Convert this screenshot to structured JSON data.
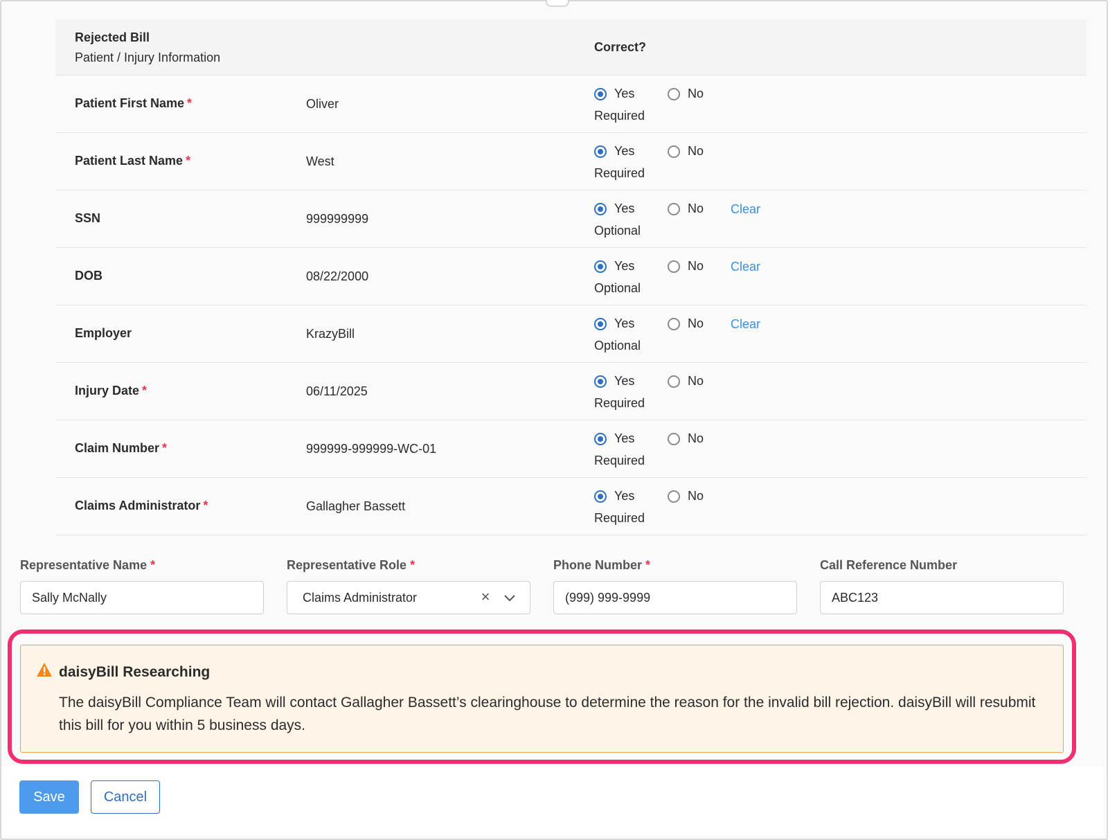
{
  "table": {
    "header": {
      "title": "Rejected Bill",
      "subtitle": "Patient / Injury Information",
      "correct_label": "Correct?"
    },
    "yes_label": "Yes",
    "no_label": "No",
    "clear_label": "Clear",
    "required_mark": "*",
    "rows": [
      {
        "label": "Patient First Name",
        "required": true,
        "value": "Oliver",
        "selected": "Yes",
        "hint": "Required",
        "clearable": false
      },
      {
        "label": "Patient Last Name",
        "required": true,
        "value": "West",
        "selected": "Yes",
        "hint": "Required",
        "clearable": false
      },
      {
        "label": "SSN",
        "required": false,
        "value": "999999999",
        "selected": "Yes",
        "hint": "Optional",
        "clearable": true
      },
      {
        "label": "DOB",
        "required": false,
        "value": "08/22/2000",
        "selected": "Yes",
        "hint": "Optional",
        "clearable": true
      },
      {
        "label": "Employer",
        "required": false,
        "value": "KrazyBill",
        "selected": "Yes",
        "hint": "Optional",
        "clearable": true
      },
      {
        "label": "Injury Date",
        "required": true,
        "value": "06/11/2025",
        "selected": "Yes",
        "hint": "Required",
        "clearable": false
      },
      {
        "label": "Claim Number",
        "required": true,
        "value": "999999-999999-WC-01",
        "selected": "Yes",
        "hint": "Required",
        "clearable": false
      },
      {
        "label": "Claims Administrator",
        "required": true,
        "value": "Gallagher Bassett",
        "selected": "Yes",
        "hint": "Required",
        "clearable": false
      }
    ]
  },
  "fields": {
    "rep_name": {
      "label": "Representative Name",
      "value": "Sally McNally"
    },
    "rep_role": {
      "label": "Representative Role",
      "value": "Claims Administrator"
    },
    "phone": {
      "label": "Phone Number",
      "value": "(999) 999-9999"
    },
    "call_ref": {
      "label": "Call Reference Number",
      "value": "ABC123"
    }
  },
  "alert": {
    "title": "daisyBill Researching",
    "body": "The daisyBill Compliance Team will contact Gallagher Bassett’s clearinghouse to determine the reason for the invalid bill rejection. daisyBill will resubmit this bill for you within 5 business days."
  },
  "footer": {
    "save_label": "Save",
    "cancel_label": "Cancel"
  },
  "colors": {
    "accent": "#2d6fc2",
    "link": "#3b8fe0",
    "required": "#e8374f",
    "highlight": "#ef2f6f",
    "alert_bg": "#fff4e8",
    "alert_border": "#e9a25c",
    "warning_icon": "#f0891d"
  }
}
